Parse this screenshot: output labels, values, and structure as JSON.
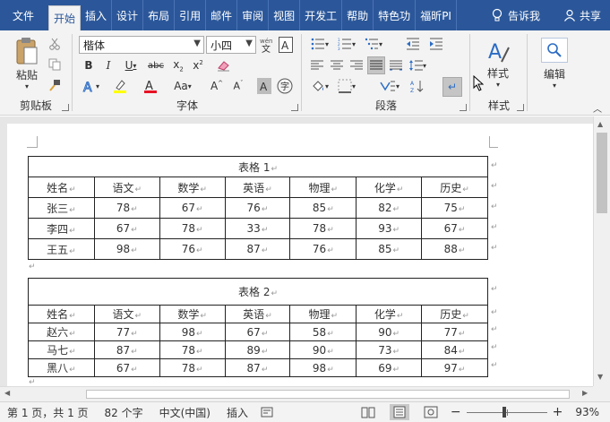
{
  "tabs": [
    "文件",
    "开始",
    "插入",
    "设计",
    "布局",
    "引用",
    "邮件",
    "审阅",
    "视图",
    "开发工",
    "帮助",
    "特色功",
    "福昕PI"
  ],
  "tell_me": "告诉我",
  "share": "共享",
  "ribbon": {
    "clipboard": {
      "paste": "粘贴",
      "label": "剪贴板"
    },
    "font": {
      "name": "楷体",
      "size": "小四",
      "label": "字体"
    },
    "paragraph": {
      "label": "段落"
    },
    "styles": {
      "button": "样式",
      "label": "样式"
    },
    "editing": {
      "button": "编辑"
    }
  },
  "mark": "↵",
  "table1": {
    "title": "表格 1",
    "headers": [
      "姓名",
      "语文",
      "数学",
      "英语",
      "物理",
      "化学",
      "历史"
    ],
    "rows": [
      [
        "张三",
        "78",
        "67",
        "76",
        "85",
        "82",
        "75"
      ],
      [
        "李四",
        "67",
        "78",
        "33",
        "78",
        "93",
        "67"
      ],
      [
        "王五",
        "98",
        "76",
        "87",
        "76",
        "85",
        "88"
      ]
    ]
  },
  "table2": {
    "title": "表格 2",
    "headers": [
      "姓名",
      "语文",
      "数学",
      "英语",
      "物理",
      "化学",
      "历史"
    ],
    "rows": [
      [
        "赵六",
        "77",
        "98",
        "67",
        "58",
        "90",
        "77"
      ],
      [
        "马七",
        "87",
        "78",
        "89",
        "90",
        "73",
        "84"
      ],
      [
        "黑八",
        "67",
        "78",
        "87",
        "98",
        "69",
        "97"
      ]
    ]
  },
  "status": {
    "page": "第 1 页，共 1 页",
    "words": "82 个字",
    "language": "中文(中国)",
    "mode": "插入",
    "zoom": "93%"
  },
  "colors": {
    "ribbon_blue": "#2b579a",
    "highlight": "#ffff00",
    "font_red": "#e81123"
  }
}
